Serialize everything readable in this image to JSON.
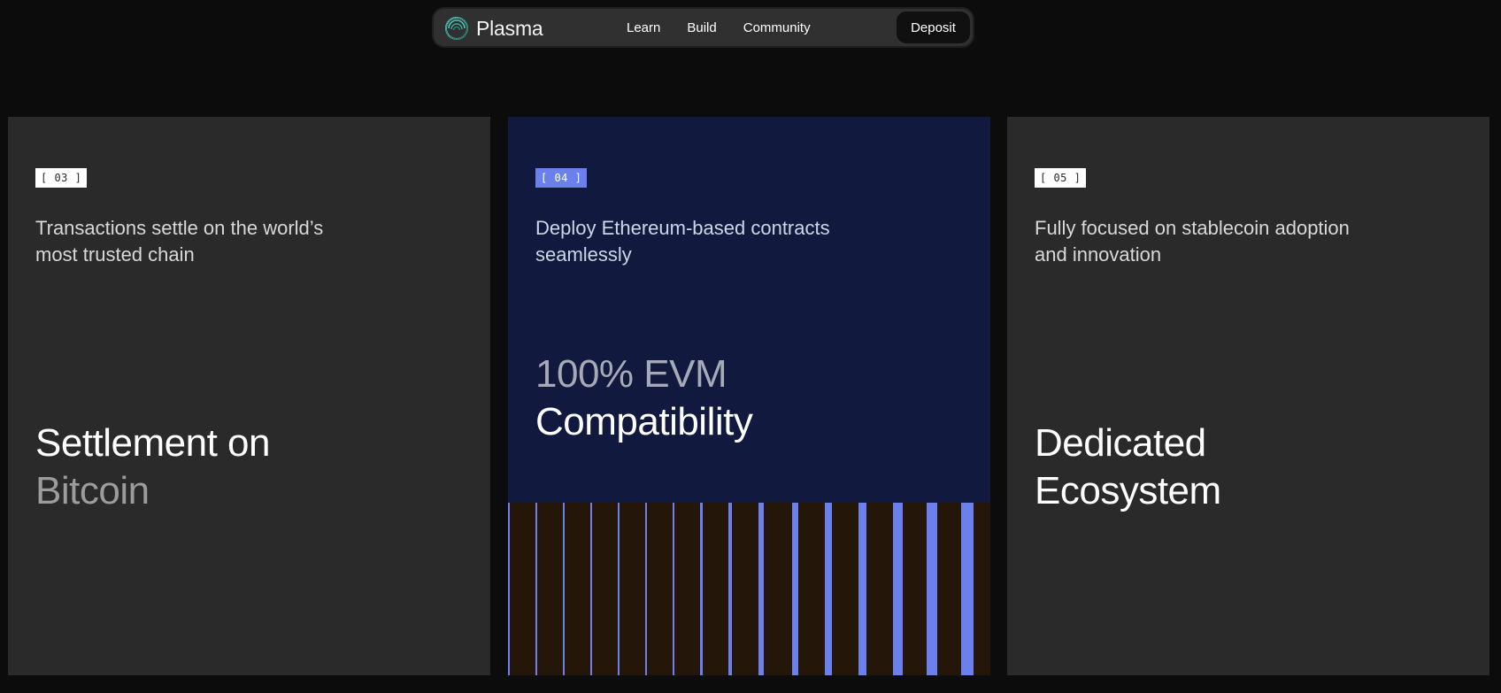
{
  "nav": {
    "brand": "Plasma",
    "links": [
      "Learn",
      "Build",
      "Community"
    ],
    "cta": "Deposit"
  },
  "cards": [
    {
      "tag": "[ 03 ]",
      "description": "Transactions settle on the world’s most trusted chain",
      "headline_line1": "Settlement on",
      "headline_line2": "Bitcoin"
    },
    {
      "tag": "[ 04 ]",
      "description": "Deploy Ethereum-based contracts seamlessly",
      "headline_line1": "100% EVM",
      "headline_line2": "Compatibility"
    },
    {
      "tag": "[ 05 ]",
      "description": "Fully focused on stablecoin adoption and innovation",
      "headline_line1": "Dedicated",
      "headline_line2": "Ecosystem"
    }
  ],
  "colors": {
    "page_bg": "#0c0c0c",
    "card_gray": "#2a2a2a",
    "card_navy": "#111a3e",
    "accent_blue": "#6b80ec",
    "bars_bg": "#241609"
  },
  "icons": {
    "logo": "plasma-logo-icon"
  }
}
